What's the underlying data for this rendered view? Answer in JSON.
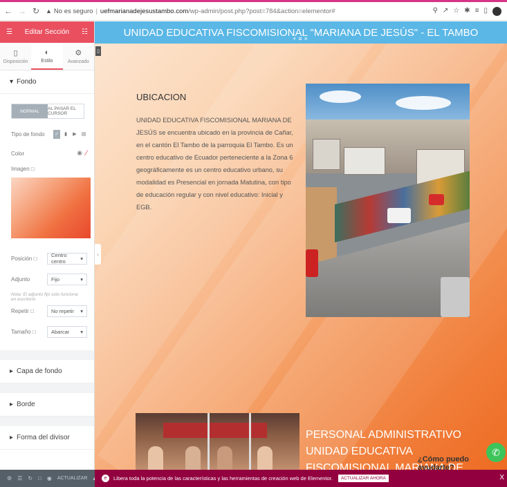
{
  "browser": {
    "security_label": "No es seguro",
    "url_host": "uefmarianadejesustambo.com",
    "url_path": "/wp-admin/post.php?post=784&action=elementor#"
  },
  "sidebar": {
    "title": "Editar Sección",
    "tabs": [
      {
        "label": "Disposición",
        "icon": "layout-icon"
      },
      {
        "label": "Estilo",
        "icon": "half-circle-icon"
      },
      {
        "label": "Avanzado",
        "icon": "gear-icon"
      }
    ],
    "sections": {
      "fondo": "Fondo",
      "capa": "Capa de fondo",
      "borde": "Borde",
      "divisor": "Forma del divisor"
    },
    "state_tabs": [
      "NORMAL",
      "AL PASAR EL CURSOR"
    ],
    "labels": {
      "tipo": "Tipo de fondo",
      "color": "Color",
      "imagen": "Imagen",
      "posicion": "Posición",
      "adjunto": "Adjunto",
      "repetir": "Repetir",
      "tamano": "Tamaño"
    },
    "values": {
      "posicion": "Centro centro",
      "adjunto": "Fijo",
      "repetir": "No repetir",
      "tamano": "Abarcar"
    },
    "note": "Nota: El adjunto fijo solo funciona en escritorio",
    "footer_update": "ACTUALIZAR"
  },
  "canvas": {
    "site_title": "UNIDAD EDUCATIVA FISCOMISIONAL \"MARIANA DE JESÚS\" - EL TAMBO",
    "ubicacion_heading": "UBICACION",
    "ubicacion_text": "UNIDAD EDUCATIVA FISCOMISIONAL MARIANA DE JESÚS se encuentra ubicado en la provincia de Cañar, en el cantón El Tambo de la parroquia El Tambo. Es un centro educativo de Ecuador perteneciente a la Zona 6 geográficamente es un centro educativo urbano, su modalidad es Presencial en jornada Matutina, con tipo de educación regular y con nivel educativo: Inicial y EGB.",
    "personal_heading": "PERSONAL ADMINISTRATIVO UNIDAD EDUCATIVA FISCOMISIONAL MARIANA DE",
    "help_text": "¿Cómo puedo ayudarte?"
  },
  "promo": {
    "text": "Libera toda la potencia de las características y las herramientas de creación web de Elementor.",
    "cta": "ACTUALIZAR AHORA"
  },
  "colors": {
    "elementor_accent": "#e94f5f",
    "header_blue": "#5ab7e6",
    "promo_bg": "#93003f"
  }
}
